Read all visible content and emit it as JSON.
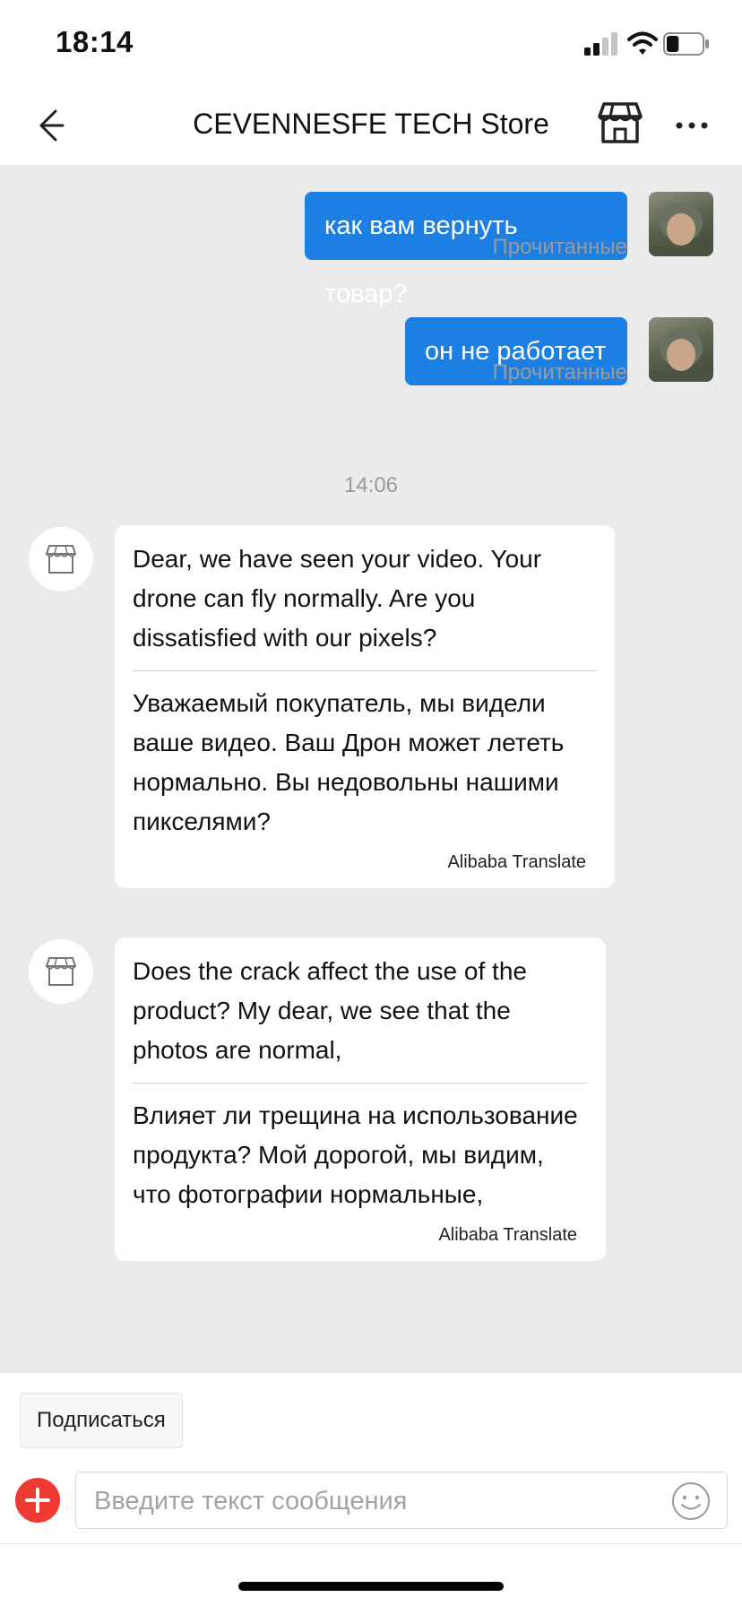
{
  "status_bar": {
    "time": "18:14",
    "battery_level": 0.35
  },
  "header": {
    "back_icon": "arrow-left-icon",
    "title": "CEVENNESFE TECH Store",
    "store_icon": "storefront-icon",
    "more_icon": "more-dots-icon"
  },
  "chat": {
    "sent": [
      {
        "text": "как вам вернуть товар?",
        "status": "Прочитанные"
      },
      {
        "text": "он не работает",
        "status": "Прочитанные"
      }
    ],
    "timestamp": "14:06",
    "received": [
      {
        "original": "Dear, we have seen your video. Your drone can fly normally. Are you dissatisfied with our pixels?",
        "translated": "Уважаемый покупатель, мы видели ваше видео. Ваш Дрон может лететь нормально. Вы недовольны нашими пикселями?",
        "source": "Alibaba Translate"
      },
      {
        "original": "Does the crack affect the use of the product? My dear, we see that the photos are normal,",
        "translated": "Влияет ли трещина на использование продукта? Мой дорогой, мы видим, что фотографии нормальные,",
        "source": "Alibaba Translate"
      }
    ]
  },
  "footer": {
    "subscribe_label": "Подписаться",
    "input_placeholder": "Введите текст сообщения",
    "input_value": "",
    "plus_icon": "plus-icon",
    "emoji_icon": "emoji-icon"
  },
  "colors": {
    "accent_blue": "#1b7fe3",
    "chat_background": "#ebebeb",
    "plus_red": "#ef3b33"
  }
}
